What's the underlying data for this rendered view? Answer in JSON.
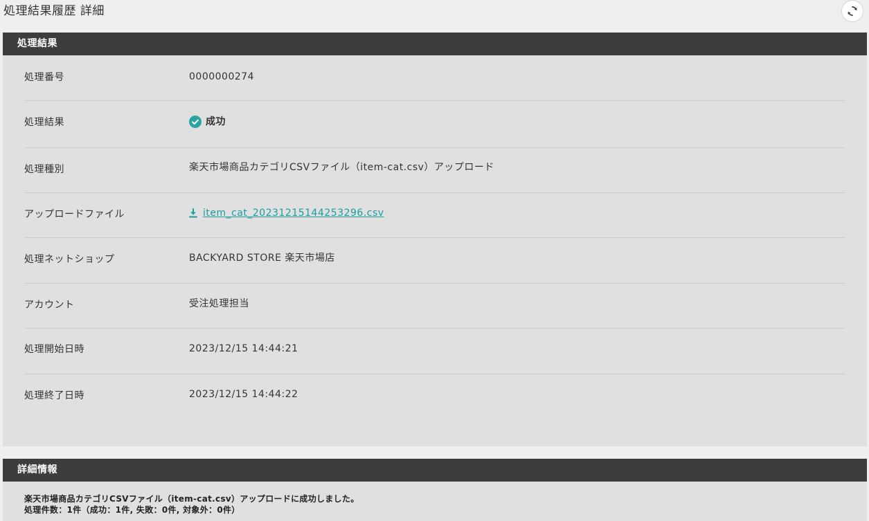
{
  "page": {
    "title": "処理結果履歴 詳細",
    "refresh_icon": "refresh-icon"
  },
  "result_section": {
    "header": "処理結果",
    "rows": [
      {
        "label": "処理番号",
        "value": "0000000274"
      },
      {
        "label": "処理結果",
        "value": "成功",
        "icon": "check-circle-icon",
        "icon_color": "#2aa3a3"
      },
      {
        "label": "処理種別",
        "value": "楽天市場商品カテゴリCSVファイル（item-cat.csv）アップロード"
      },
      {
        "label": "アップロードファイル",
        "value": "item_cat_20231215144253296.csv",
        "icon": "download-icon",
        "link_color": "#1a9d9d"
      },
      {
        "label": "処理ネットショップ",
        "value": "BACKYARD STORE 楽天市場店"
      },
      {
        "label": "アカウント",
        "value": "受注処理担当"
      },
      {
        "label": "処理開始日時",
        "value": "2023/12/15 14:44:21"
      },
      {
        "label": "処理終了日時",
        "value": "2023/12/15 14:44:22"
      }
    ]
  },
  "detail_section": {
    "header": "詳細情報",
    "lines": [
      "楽天市場商品カテゴリCSVファイル（item-cat.csv）アップロードに成功しました。",
      "処理件数：1件（成功：1件, 失敗：0件, 対象外：0件）"
    ]
  },
  "colors": {
    "header_bar": "#3d3d3d",
    "panel_bg": "#e0e0e0",
    "page_bg": "#efefef",
    "accent": "#2aa3a3"
  }
}
